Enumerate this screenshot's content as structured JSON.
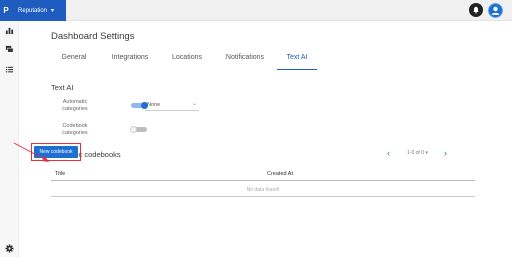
{
  "topbar": {
    "brand_logo": "P",
    "brand_name": "Reputation",
    "notifications_icon": "bell-icon",
    "user_icon": "user-avatar-icon"
  },
  "sidebar": {
    "items": [
      {
        "icon": "bar-chart-icon"
      },
      {
        "icon": "chat-icon"
      },
      {
        "icon": "list-icon"
      }
    ],
    "settings_icon": "gear-icon"
  },
  "page": {
    "title": "Dashboard Settings",
    "tabs": [
      {
        "label": "General",
        "active": false
      },
      {
        "label": "Integrations",
        "active": false
      },
      {
        "label": "Locations",
        "active": false
      },
      {
        "label": "Notifications",
        "active": false
      },
      {
        "label": "Text AI",
        "active": true
      }
    ]
  },
  "text_ai": {
    "heading": "Text AI",
    "auto_categories": {
      "label": "Automatic categories",
      "enabled": true,
      "select_value": "None"
    },
    "codebook_categories": {
      "label": "Codebook categories",
      "enabled": false
    }
  },
  "codebooks": {
    "heading": "Semantic codebooks",
    "new_button": "New codebook",
    "pager_info": "1-0 of 0 ▾",
    "columns": [
      "Title",
      "Created At"
    ],
    "empty_text": "No data found!"
  },
  "colors": {
    "brand": "#1f5cc0",
    "accent": "#1f6fd1",
    "highlight": "#e0313a"
  }
}
